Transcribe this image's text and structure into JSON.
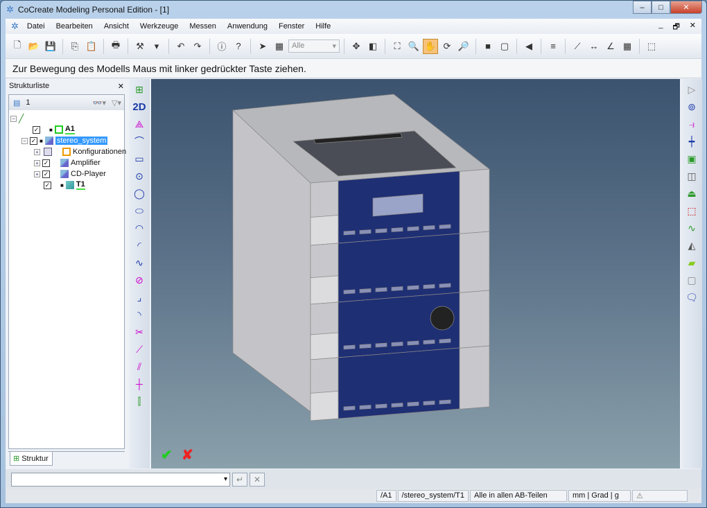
{
  "window": {
    "title": "CoCreate Modeling Personal Edition - [1]",
    "minimize": "–",
    "maximize": "□",
    "close": "✕"
  },
  "menu": {
    "items": [
      "Datei",
      "Bearbeiten",
      "Ansicht",
      "Werkzeuge",
      "Messen",
      "Anwendung",
      "Fenster",
      "Hilfe"
    ],
    "mdi": [
      "_",
      "🗗",
      "✕"
    ]
  },
  "toolbar": {
    "group1": [
      {
        "icon": "new-document-icon",
        "g": "🗋"
      },
      {
        "icon": "open-folder-icon",
        "g": "📂"
      },
      {
        "icon": "save-icon",
        "g": "💾"
      }
    ],
    "group2": [
      {
        "icon": "copy-icon",
        "g": "⎘"
      },
      {
        "icon": "paste-icon",
        "g": "📋"
      }
    ],
    "group3": [
      {
        "icon": "print-icon",
        "g": "🖶"
      }
    ],
    "group4": [
      {
        "icon": "tools-icon",
        "g": "⚒"
      },
      {
        "icon": "dropdown-arrow-icon",
        "g": "▾"
      }
    ],
    "group5": [
      {
        "icon": "undo-icon",
        "g": "↶"
      },
      {
        "icon": "redo-icon",
        "g": "↷"
      }
    ],
    "group6": [
      {
        "icon": "info-icon",
        "g": "ⓘ"
      },
      {
        "icon": "help-icon",
        "g": "?"
      }
    ],
    "group7": [
      {
        "icon": "select-arrow-icon",
        "g": "➤"
      },
      {
        "icon": "table-select-icon",
        "g": "▦"
      }
    ],
    "filter_value": "Alle",
    "group8": [
      {
        "icon": "magnet-select-icon",
        "g": "✥"
      },
      {
        "icon": "part-select-icon",
        "g": "◧"
      }
    ],
    "group9": [
      {
        "icon": "fit-view-icon",
        "g": "⛶"
      },
      {
        "icon": "zoom-window-icon",
        "g": "🔍"
      },
      {
        "icon": "pan-view-icon",
        "g": "✋",
        "active": true
      },
      {
        "icon": "rotate-view-icon",
        "g": "⟳"
      },
      {
        "icon": "zoom-in-icon",
        "g": "🔎"
      }
    ],
    "group10": [
      {
        "icon": "shaded-view-icon",
        "g": "■"
      },
      {
        "icon": "wireframe-view-icon",
        "g": "▢"
      }
    ],
    "group11": [
      {
        "icon": "previous-view-icon",
        "g": "◀"
      }
    ],
    "group12": [
      {
        "icon": "section-plane-icon",
        "g": "≡"
      }
    ],
    "group13": [
      {
        "icon": "measure-distance-icon",
        "g": "⟋"
      },
      {
        "icon": "measure-length-icon",
        "g": "↔"
      },
      {
        "icon": "measure-angle-icon",
        "g": "∠"
      },
      {
        "icon": "calculator-icon",
        "g": "▦"
      }
    ],
    "group14": [
      {
        "icon": "part-properties-icon",
        "g": "⬚"
      }
    ]
  },
  "hint": "Zur Bewegung des Modells Maus mit linker gedrückter Taste ziehen.",
  "structure": {
    "title": "Strukturliste",
    "close": "✕",
    "view_number": "1",
    "binoculars": "👓▾",
    "filter": "▽▾",
    "nodes": [
      {
        "label": "A1",
        "checked": "✓"
      },
      {
        "label": "stereo_system",
        "checked": "✓"
      },
      {
        "label": "Konfigurationen"
      },
      {
        "label": "Amplifier",
        "checked": "✓"
      },
      {
        "label": "CD-Player",
        "checked": "✓"
      },
      {
        "label": "T1",
        "checked": "✓"
      }
    ],
    "tab": "Struktur"
  },
  "left_tools": [
    {
      "icon": "structure-tree-icon",
      "g": "⊞",
      "c": "#2a9a2a"
    },
    {
      "icon": "2d-icon",
      "g": "2D",
      "c": "#1a3aa8"
    },
    {
      "icon": "workplane-icon",
      "g": "⟁",
      "c": "#c0c"
    },
    {
      "icon": "line-arc-icon",
      "g": "⌒",
      "c": "#1a3aa8"
    },
    {
      "icon": "rectangle-icon",
      "g": "▭",
      "c": "#1a3aa8"
    },
    {
      "icon": "circle-center-icon",
      "g": "⊙",
      "c": "#1a3aa8"
    },
    {
      "icon": "circle-icon",
      "g": "◯",
      "c": "#1a3aa8"
    },
    {
      "icon": "ellipse-icon",
      "g": "⬭",
      "c": "#1a3aa8"
    },
    {
      "icon": "arc-icon",
      "g": "◠",
      "c": "#1a3aa8"
    },
    {
      "icon": "arc-tangent-icon",
      "g": "◜",
      "c": "#1a3aa8"
    },
    {
      "icon": "spline-icon",
      "g": "∿",
      "c": "#1a3aa8"
    },
    {
      "icon": "offset-icon",
      "g": "⊘",
      "c": "#c0c"
    },
    {
      "icon": "fillet-icon",
      "g": "⌟",
      "c": "#1a3aa8"
    },
    {
      "icon": "chamfer-icon",
      "g": "◝",
      "c": "#1a3aa8"
    },
    {
      "icon": "trim-icon",
      "g": "✂",
      "c": "#c0c"
    },
    {
      "icon": "construction-line-icon",
      "g": "⟋",
      "c": "#c0c"
    },
    {
      "icon": "parallel-line-icon",
      "g": "⫽",
      "c": "#c0c"
    },
    {
      "icon": "cross-line-icon",
      "g": "┼",
      "c": "#c0c"
    },
    {
      "icon": "mirror-icon",
      "g": "⫿",
      "c": "#2a9a2a"
    }
  ],
  "right_tools": [
    {
      "icon": "play-icon",
      "g": "▷",
      "c": "#888"
    },
    {
      "icon": "revolve-icon",
      "g": "⊚",
      "c": "#1a3aa8"
    },
    {
      "icon": "sweep-icon",
      "g": "⥽",
      "c": "#c0c"
    },
    {
      "icon": "axis-icon",
      "g": "┿",
      "c": "#1a3aa8"
    },
    {
      "icon": "profile-icon",
      "g": "▣",
      "c": "#2a9a2a"
    },
    {
      "icon": "extrude-icon",
      "g": "◫",
      "c": "#555"
    },
    {
      "icon": "punch-icon",
      "g": "⏏",
      "c": "#2a9a2a"
    },
    {
      "icon": "box-icon",
      "g": "⬚",
      "c": "#c00"
    },
    {
      "icon": "curve-icon",
      "g": "∿",
      "c": "#2a9a2a"
    },
    {
      "icon": "blend-icon",
      "g": "◭",
      "c": "#555"
    },
    {
      "icon": "surface-icon",
      "g": "▰",
      "c": "#8c2"
    },
    {
      "icon": "note-icon",
      "g": "▢",
      "c": "#888"
    },
    {
      "icon": "comment-icon",
      "g": "🗨",
      "c": "#1a3aa8"
    }
  ],
  "viewport": {
    "accept": "✔",
    "cancel": "✘"
  },
  "cmdline": {
    "value": "",
    "enter": "↵",
    "clear": "✕"
  },
  "status": {
    "fields": [
      "/A1",
      "/stereo_system/T1",
      "Alle in allen AB-Teilen",
      "mm | Grad | g",
      "⚠"
    ]
  },
  "colors": {
    "selection": "#3399ff",
    "device_front": "#1f2f74",
    "device_body": "#c8c8cc",
    "viewport_top": "#3c536f",
    "viewport_bottom": "#8aa0ab"
  }
}
